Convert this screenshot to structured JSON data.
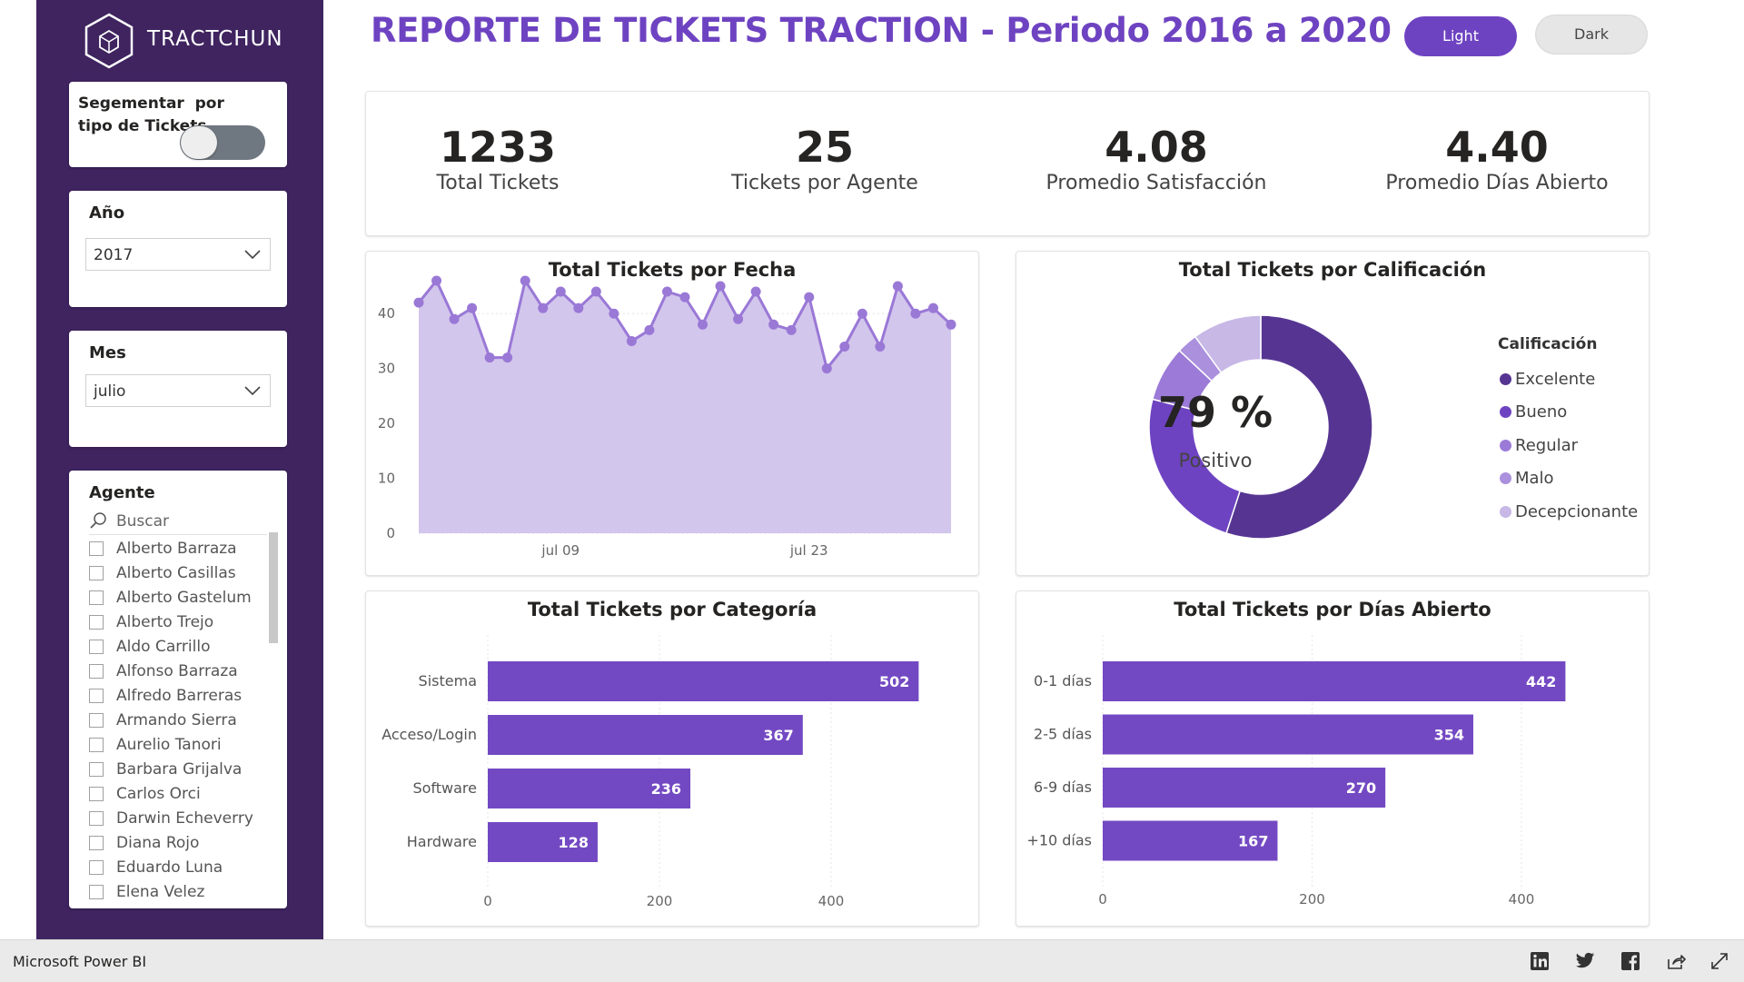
{
  "brand": {
    "name": "TRACTCHUN"
  },
  "header": {
    "title": "REPORTE DE TICKETS TRACTION - Periodo 2016 a 2020",
    "light_label": "Light",
    "dark_label": "Dark"
  },
  "filters": {
    "segment": {
      "label": "Segementar  por tipo de Tickets",
      "enabled": false
    },
    "year": {
      "label": "Año",
      "value": "2017"
    },
    "month": {
      "label": "Mes",
      "value": "julio"
    },
    "agent": {
      "label": "Agente",
      "search_placeholder": "Buscar",
      "items": [
        "Alberto Barraza",
        "Alberto Casillas",
        "Alberto Gastelum",
        "Alberto Trejo",
        "Aldo Carrillo",
        "Alfonso Barraza",
        "Alfredo Barreras",
        "Armando Sierra",
        "Aurelio Tanori",
        "Barbara Grijalva",
        "Carlos Orci",
        "Darwin Echeverry",
        "Diana Rojo",
        "Eduardo Luna",
        "Elena Velez"
      ]
    }
  },
  "kpis": [
    {
      "value": "1233",
      "label": "Total Tickets"
    },
    {
      "value": "25",
      "label": "Tickets por Agente"
    },
    {
      "value": "4.08",
      "label": "Promedio Satisfacción"
    },
    {
      "value": "4.40",
      "label": "Promedio Días Abierto"
    }
  ],
  "colors": {
    "accent": "#6e43c1",
    "sidebar": "#3f2460",
    "bar": "#7349c3",
    "area_fill": "#d2c6ec",
    "line": "#9a78d6",
    "donut": [
      "#563592",
      "#6e43c1",
      "#9b7ad8",
      "#ab90de",
      "#c7b8e6"
    ]
  },
  "chart_data": [
    {
      "type": "area",
      "title": "Total Tickets por Fecha",
      "xlabel": "",
      "ylabel": "",
      "ylim": [
        0,
        45
      ],
      "yticks": [
        0,
        10,
        20,
        30,
        40
      ],
      "x": [
        "jul 01",
        "jul 02",
        "jul 03",
        "jul 04",
        "jul 05",
        "jul 06",
        "jul 07",
        "jul 08",
        "jul 09",
        "jul 10",
        "jul 11",
        "jul 12",
        "jul 13",
        "jul 14",
        "jul 15",
        "jul 16",
        "jul 17",
        "jul 18",
        "jul 19",
        "jul 20",
        "jul 21",
        "jul 22",
        "jul 23",
        "jul 24",
        "jul 25",
        "jul 26",
        "jul 27",
        "jul 28",
        "jul 29",
        "jul 30",
        "jul 31"
      ],
      "xtick_labels": [
        "jul 09",
        "jul 23"
      ],
      "values": [
        42,
        46,
        39,
        41,
        32,
        32,
        46,
        41,
        44,
        41,
        44,
        40,
        35,
        37,
        44,
        43,
        38,
        45,
        39,
        44,
        38,
        37,
        43,
        30,
        34,
        40,
        34,
        45,
        40,
        41,
        38
      ],
      "grid": false
    },
    {
      "type": "pie",
      "title": "Total Tickets por Calificación",
      "center_value": "79 %",
      "center_label": "Positivo",
      "legend_title": "Calificación",
      "legend_position": "right",
      "categories": [
        "Excelente",
        "Bueno",
        "Regular",
        "Malo",
        "Decepcionante"
      ],
      "values": [
        55,
        24,
        8,
        3,
        10
      ]
    },
    {
      "type": "bar",
      "orientation": "horizontal",
      "title": "Total Tickets por Categoría",
      "categories": [
        "Sistema",
        "Acceso/Login",
        "Software",
        "Hardware"
      ],
      "values": [
        502,
        367,
        236,
        128
      ],
      "xlim": [
        0,
        520
      ],
      "xticks": [
        0,
        200,
        400
      ]
    },
    {
      "type": "bar",
      "orientation": "horizontal",
      "title": "Total Tickets por Días Abierto",
      "categories": [
        "0-1 días",
        "2-5 días",
        "6-9 días",
        "+10 días"
      ],
      "values": [
        442,
        354,
        270,
        167
      ],
      "xlim": [
        0,
        520
      ],
      "xticks": [
        0,
        200,
        400
      ]
    }
  ],
  "footer": {
    "app_name": "Microsoft Power BI",
    "icons": [
      "linkedin-icon",
      "twitter-icon",
      "facebook-icon",
      "share-icon",
      "fullscreen-icon"
    ]
  }
}
